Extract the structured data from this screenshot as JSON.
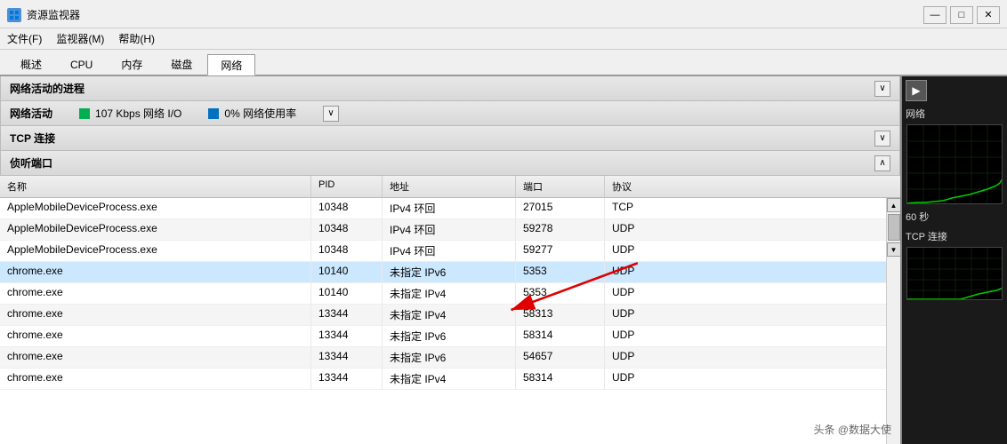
{
  "titleBar": {
    "title": "资源监视器",
    "minBtn": "—",
    "maxBtn": "□",
    "closeBtn": "✕"
  },
  "menuBar": {
    "items": [
      "文件(F)",
      "监视器(M)",
      "帮助(H)"
    ]
  },
  "tabs": {
    "items": [
      "概述",
      "CPU",
      "内存",
      "磁盘",
      "网络"
    ],
    "activeIndex": 4
  },
  "sections": {
    "networkProcess": {
      "label": "网络活动的进程"
    },
    "networkActivity": {
      "label": "网络活动",
      "indicator1": "107 Kbps 网络 I/O",
      "indicator2": "0% 网络使用率"
    },
    "tcpConnect": {
      "label": "TCP 连接"
    },
    "listenPort": {
      "label": "侦听端口"
    }
  },
  "table": {
    "headers": [
      "名称",
      "PID",
      "地址",
      "端口",
      "协议"
    ],
    "rows": [
      {
        "name": "AppleMobileDeviceProcess.exe",
        "pid": "10348",
        "address": "IPv4 环回",
        "port": "27015",
        "protocol": "TCP",
        "highlighted": false
      },
      {
        "name": "AppleMobileDeviceProcess.exe",
        "pid": "10348",
        "address": "IPv4 环回",
        "port": "59278",
        "protocol": "UDP",
        "highlighted": false
      },
      {
        "name": "AppleMobileDeviceProcess.exe",
        "pid": "10348",
        "address": "IPv4 环回",
        "port": "59277",
        "protocol": "UDP",
        "highlighted": false
      },
      {
        "name": "chrome.exe",
        "pid": "10140",
        "address": "未指定 IPv6",
        "port": "5353",
        "protocol": "UDP",
        "highlighted": true
      },
      {
        "name": "chrome.exe",
        "pid": "10140",
        "address": "未指定 IPv4",
        "port": "5353",
        "protocol": "UDP",
        "highlighted": false
      },
      {
        "name": "chrome.exe",
        "pid": "13344",
        "address": "未指定 IPv4",
        "port": "58313",
        "protocol": "UDP",
        "highlighted": false
      },
      {
        "name": "chrome.exe",
        "pid": "13344",
        "address": "未指定 IPv6",
        "port": "58314",
        "protocol": "UDP",
        "highlighted": false
      },
      {
        "name": "chrome.exe",
        "pid": "13344",
        "address": "未指定 IPv6",
        "port": "54657",
        "protocol": "UDP",
        "highlighted": false
      },
      {
        "name": "chrome.exe",
        "pid": "13344",
        "address": "未指定 IPv4",
        "port": "58314",
        "protocol": "UDP",
        "highlighted": false
      }
    ]
  },
  "rightPanel": {
    "networkLabel": "网络",
    "timeLabel": "60 秒",
    "tcpLabel": "TCP 连接"
  },
  "watermark": "头条 @数据大使"
}
